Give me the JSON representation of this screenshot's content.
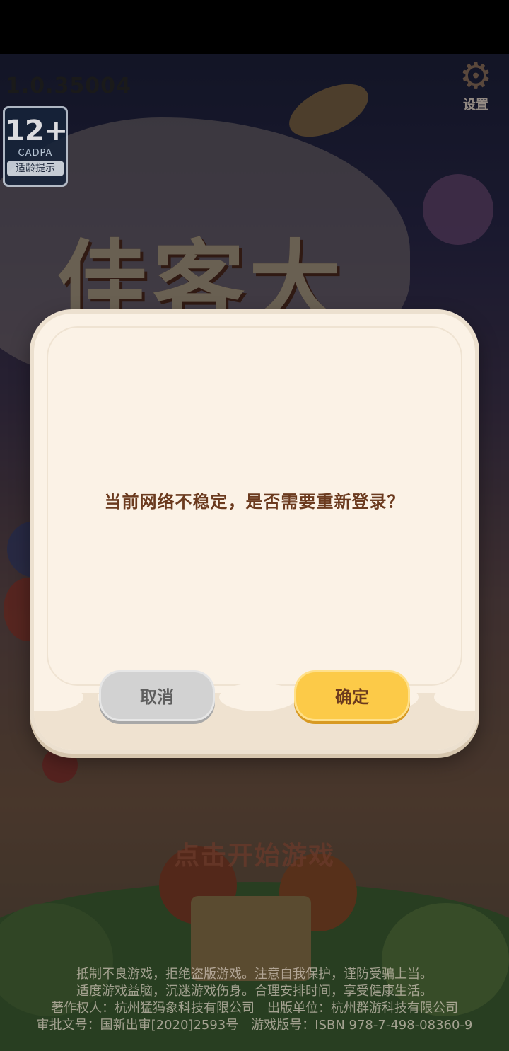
{
  "game": {
    "version": "1.0.35004",
    "age_rating": {
      "age": "12+",
      "org": "CADPA",
      "tip": "适龄提示"
    },
    "settings_label": "设置",
    "start_prompt": "点击开始游戏",
    "footer_lines": [
      "抵制不良游戏，拒绝盗版游戏。注意自我保护，谨防受骗上当。",
      "适度游戏益脑，沉迷游戏伤身。合理安排时间，享受健康生活。",
      "著作权人：杭州猛犸象科技有限公司　出版单位：杭州群游科技有限公司",
      "审批文号：国新出审[2020]2593号　游戏版号：ISBN 978-7-498-08360-9"
    ]
  },
  "dialog": {
    "message": "当前网络不稳定，是否需要重新登录？",
    "cancel_label": "取消",
    "confirm_label": "确定"
  },
  "colors": {
    "dialog_bg": "#fbf2e6",
    "confirm_button": "#fcca48",
    "cancel_button": "#d2d2d2",
    "message_text": "#6b3a1e"
  },
  "icons": {
    "settings": "gear-icon"
  }
}
